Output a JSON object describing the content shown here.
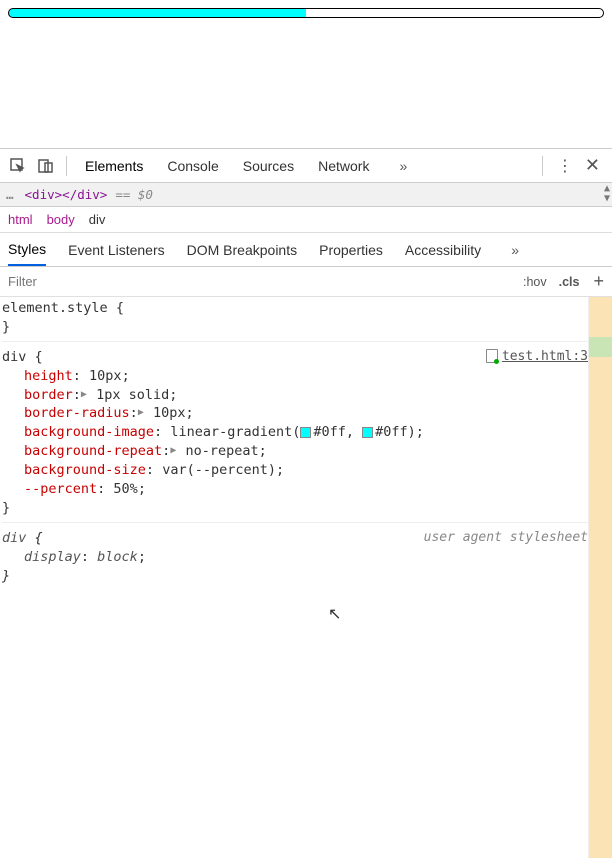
{
  "progress": {
    "percent": "50%"
  },
  "toolbar": {
    "tabs": [
      "Elements",
      "Console",
      "Sources",
      "Network"
    ],
    "active_tab": "Elements",
    "more": "»"
  },
  "dom": {
    "ellipsis": "…",
    "open_tag": "<div>",
    "close_tag": "</div>",
    "equals": "== $0"
  },
  "breadcrumb": [
    "html",
    "body",
    "div"
  ],
  "subtabs": {
    "items": [
      "Styles",
      "Event Listeners",
      "DOM Breakpoints",
      "Properties",
      "Accessibility"
    ],
    "active": "Styles",
    "more": "»"
  },
  "filter": {
    "placeholder": "Filter",
    "hov": ":hov",
    "cls": ".cls",
    "plus": "+"
  },
  "styles": {
    "element_style": {
      "selector": "element.style",
      "decls": []
    },
    "source_link": "test.html:3",
    "div_rule": {
      "selector": "div",
      "decls": [
        {
          "prop": "height",
          "val": "10px",
          "tri": false
        },
        {
          "prop": "border",
          "val": "1px solid",
          "tri": true
        },
        {
          "prop": "border-radius",
          "val": "10px",
          "tri": true
        },
        {
          "prop": "background-image",
          "val_pre": "linear-gradient(",
          "c1": "#0ff",
          "mid": ", ",
          "c2": "#0ff",
          "val_post": ")"
        },
        {
          "prop": "background-repeat",
          "val": "no-repeat",
          "tri": true
        },
        {
          "prop": "background-size",
          "val": "var(--percent)"
        },
        {
          "prop": "--percent",
          "val": "50%"
        }
      ]
    },
    "ua_rule": {
      "note": "user agent stylesheet",
      "selector": "div",
      "decls": [
        {
          "prop": "display",
          "val": "block"
        }
      ]
    }
  }
}
